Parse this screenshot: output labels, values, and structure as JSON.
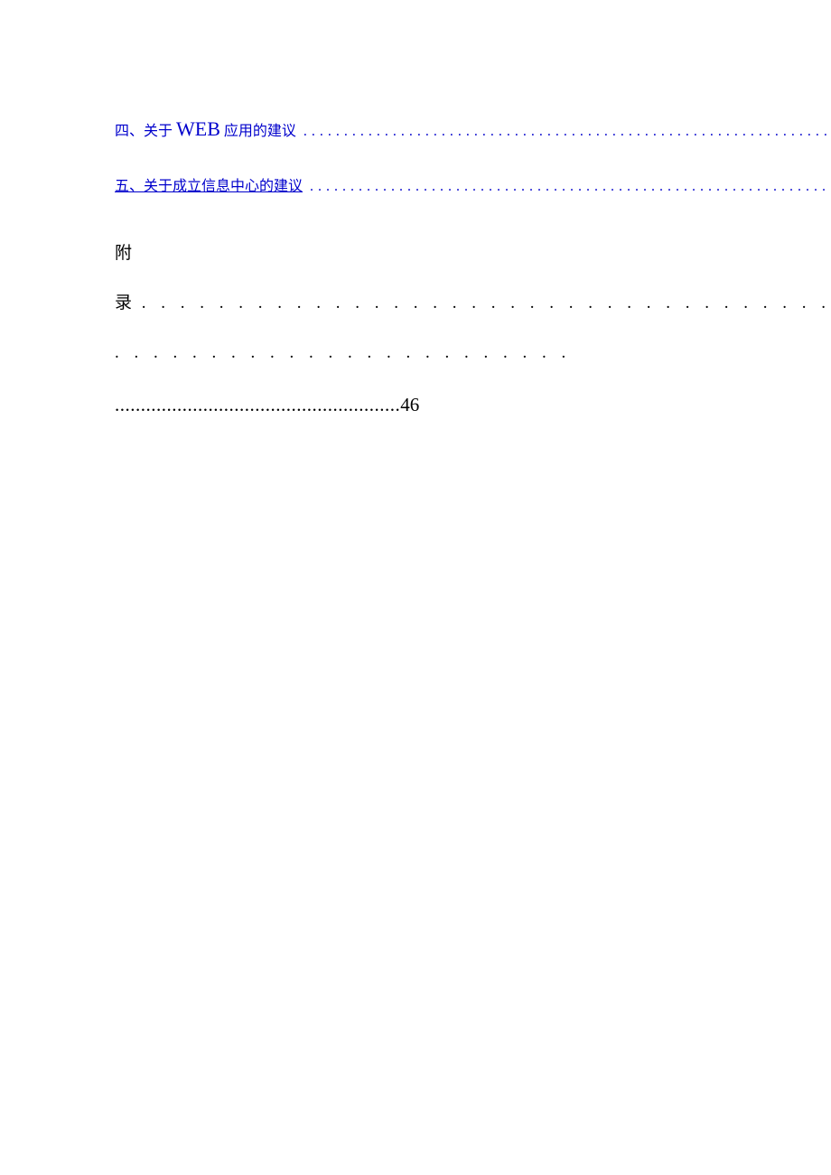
{
  "toc": {
    "item1": {
      "prefix": "四、关于 ",
      "big": "WEB",
      "suffix": " 应用的建议"
    },
    "item2": {
      "text": "五、关于成立信息中心的建议"
    }
  },
  "appendix": {
    "char1": "附",
    "char2": "录",
    "dots1": " . . . . . . . . . . . . . . . . . . . . . . . . . . . . . . . . . . . . . . . . . . . . . . . . . . . . . . . . . . . .",
    "dots2": ".......................................................",
    "page": "46"
  }
}
